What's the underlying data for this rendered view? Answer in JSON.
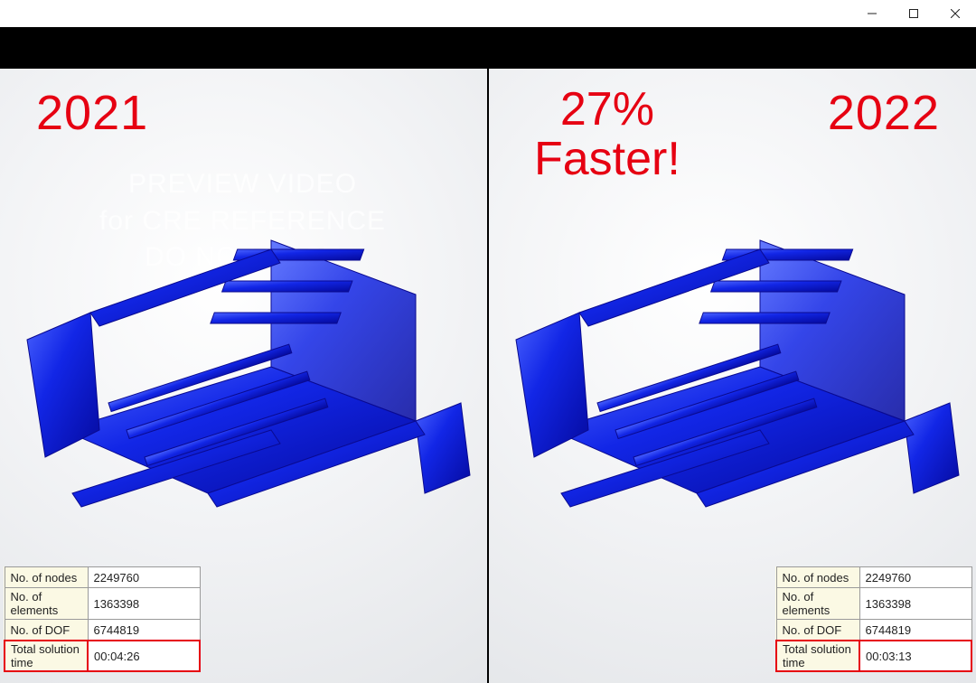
{
  "window": {
    "controls": {
      "min": "—",
      "max": "▢",
      "close": "✕"
    }
  },
  "callout": {
    "line1": "27%",
    "line2": "Faster!"
  },
  "watermark": {
    "line1": "PREVIEW VIDEO",
    "line2": "for CRE REFERENCE",
    "line3": "DO NOT POST"
  },
  "panels": {
    "left": {
      "year": "2021",
      "stats": {
        "nodes_label": "No. of nodes",
        "nodes_value": "2249760",
        "elements_label": "No. of elements",
        "elements_value": "1363398",
        "dof_label": "No. of DOF",
        "dof_value": "6744819",
        "time_label": "Total solution time",
        "time_value": "00:04:26"
      }
    },
    "right": {
      "year": "2022",
      "stats": {
        "nodes_label": "No. of nodes",
        "nodes_value": "2249760",
        "elements_label": "No. of elements",
        "elements_value": "1363398",
        "dof_label": "No. of DOF",
        "dof_value": "6744819",
        "time_label": "Total solution time",
        "time_value": "00:03:13"
      }
    }
  },
  "colors": {
    "accent_red": "#e60012",
    "model_blue": "#1226e6"
  }
}
